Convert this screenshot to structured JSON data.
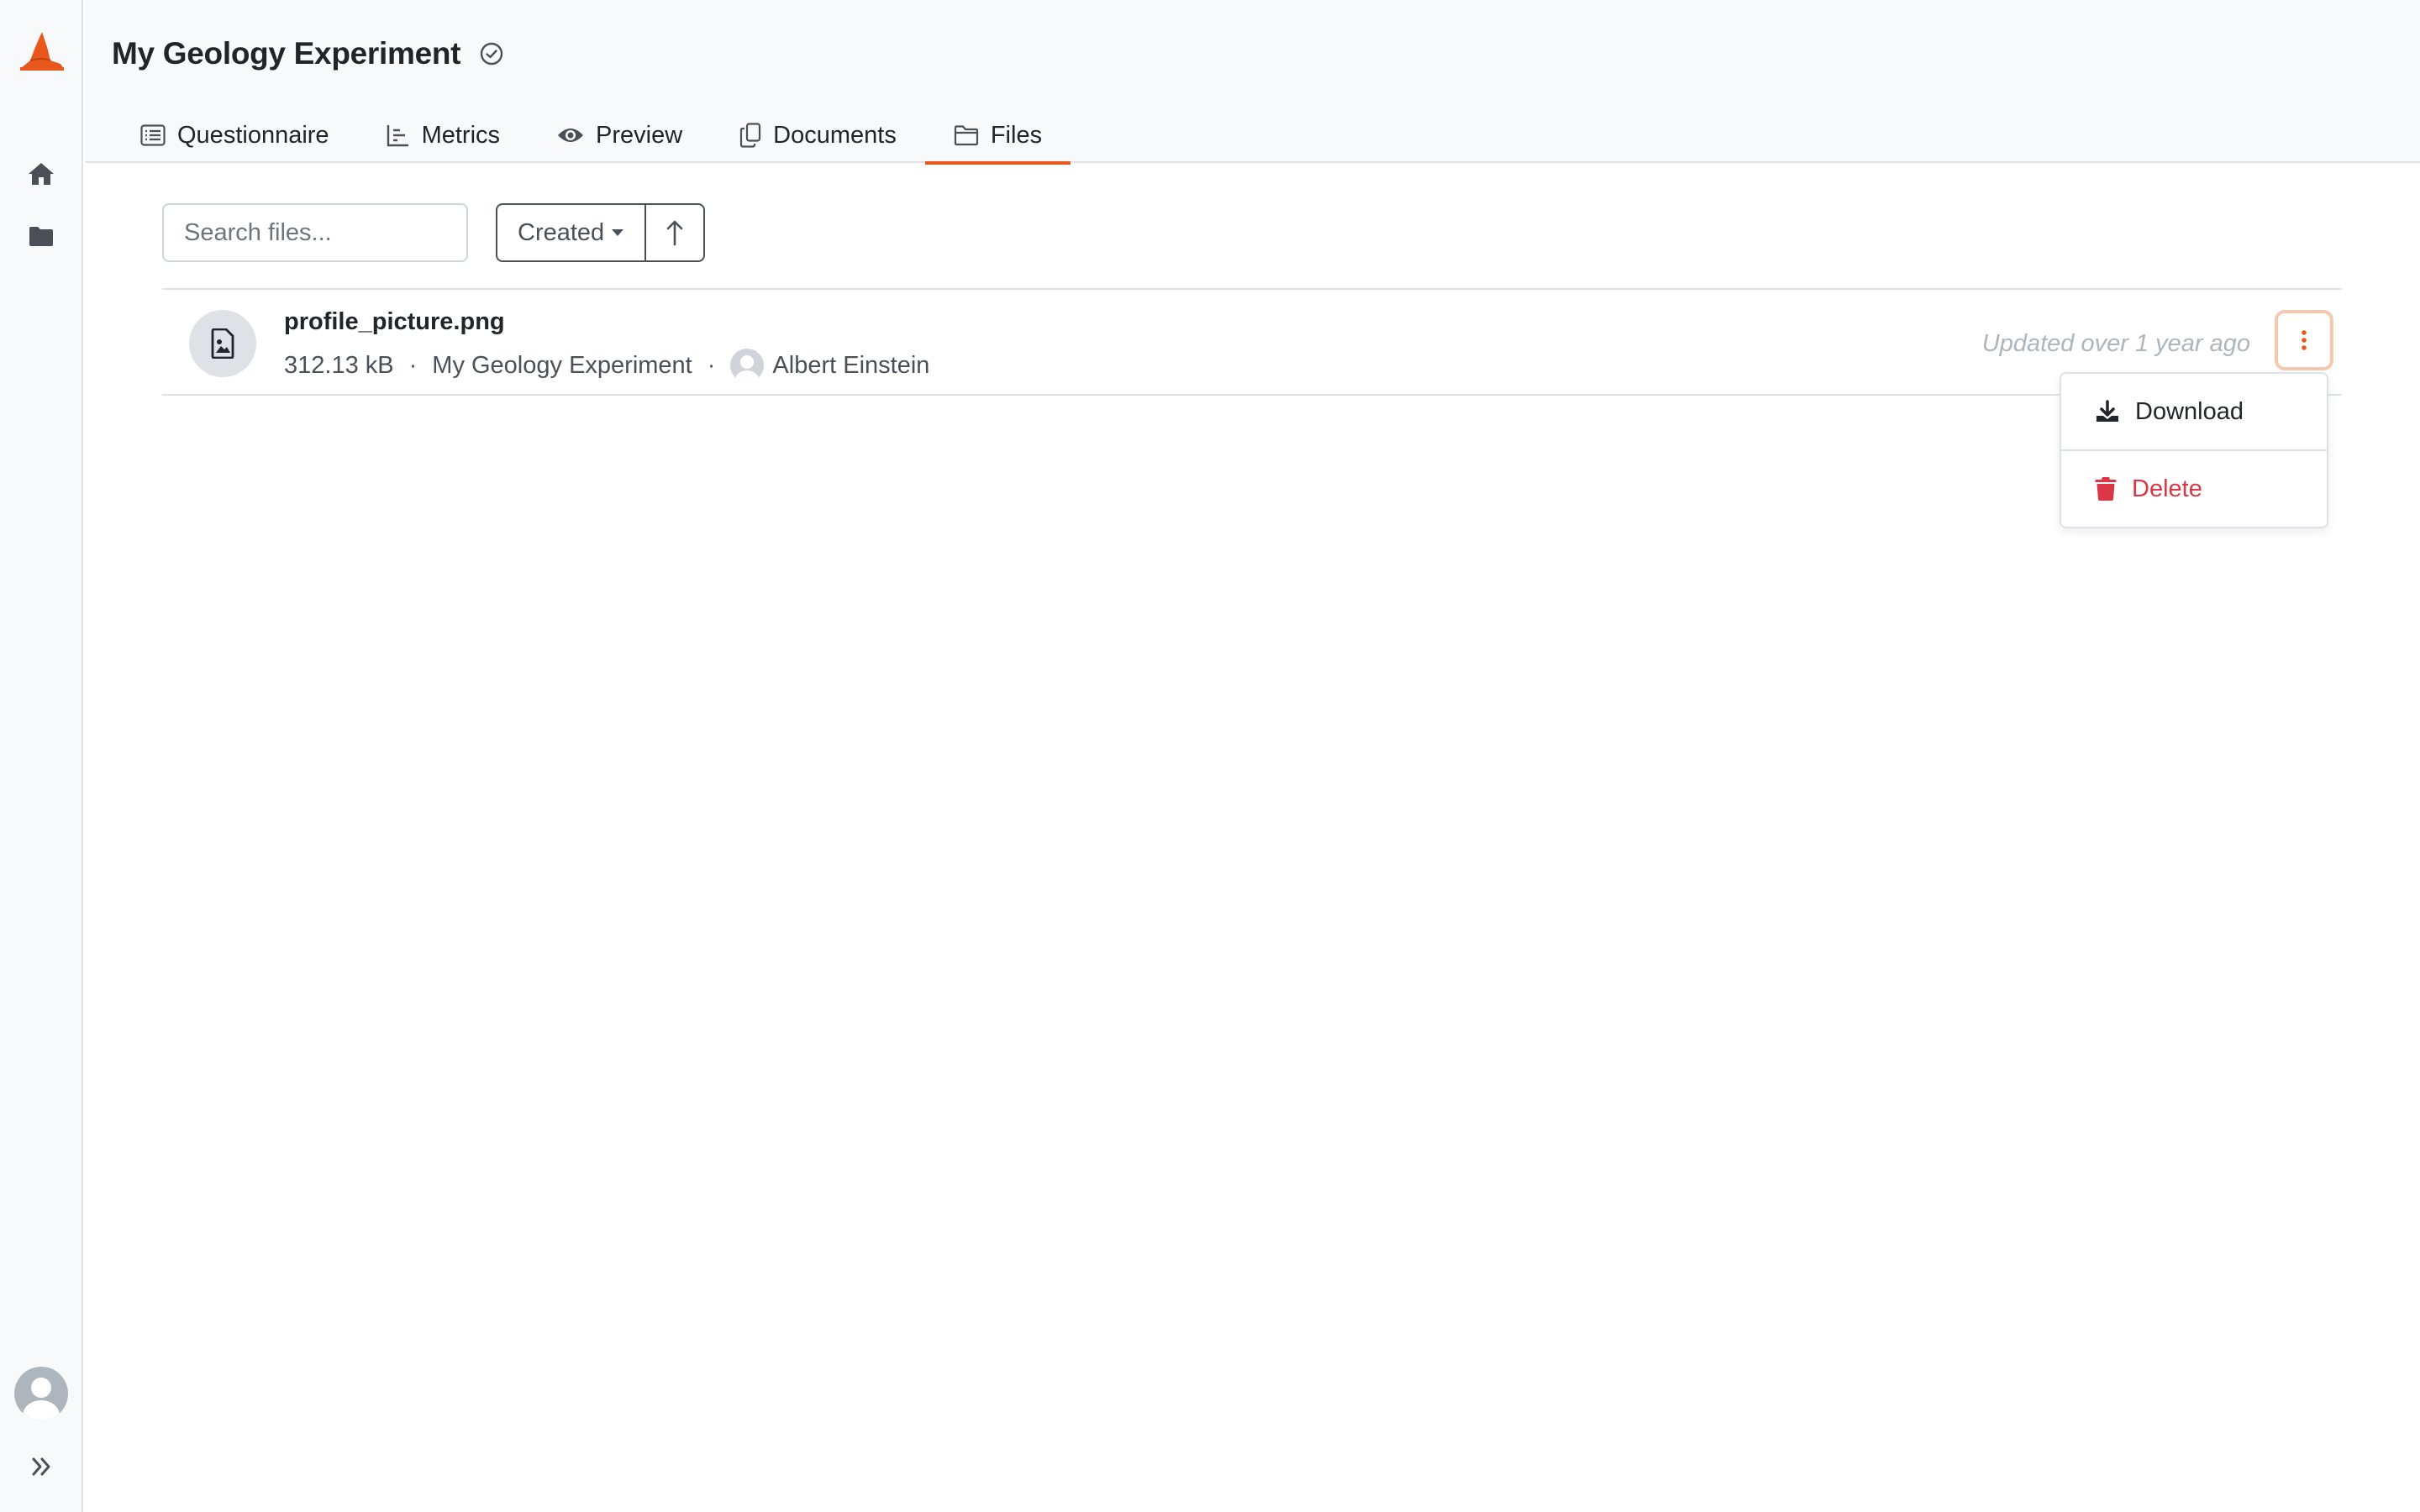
{
  "header": {
    "title": "My Geology Experiment",
    "tabs": [
      {
        "label": "Questionnaire",
        "icon": "list-icon"
      },
      {
        "label": "Metrics",
        "icon": "chart-icon"
      },
      {
        "label": "Preview",
        "icon": "eye-icon"
      },
      {
        "label": "Documents",
        "icon": "copy-icon"
      },
      {
        "label": "Files",
        "icon": "folder-icon",
        "active": true
      }
    ]
  },
  "sidebar": {
    "items": [
      {
        "icon": "home-icon"
      },
      {
        "icon": "folder-icon"
      }
    ]
  },
  "toolbar": {
    "search_placeholder": "Search files...",
    "sort_label": "Created",
    "sort_direction_icon": "arrow-up-icon"
  },
  "files": [
    {
      "name": "profile_picture.png",
      "size": "312.13 kB",
      "project": "My Geology Experiment",
      "owner": "Albert Einstein",
      "updated": "Updated over 1 year ago"
    }
  ],
  "menu": {
    "download_label": "Download",
    "delete_label": "Delete"
  },
  "colors": {
    "accent": "#e8571c",
    "danger": "#dc3545",
    "sidebar_bg": "#f8f9fa"
  }
}
